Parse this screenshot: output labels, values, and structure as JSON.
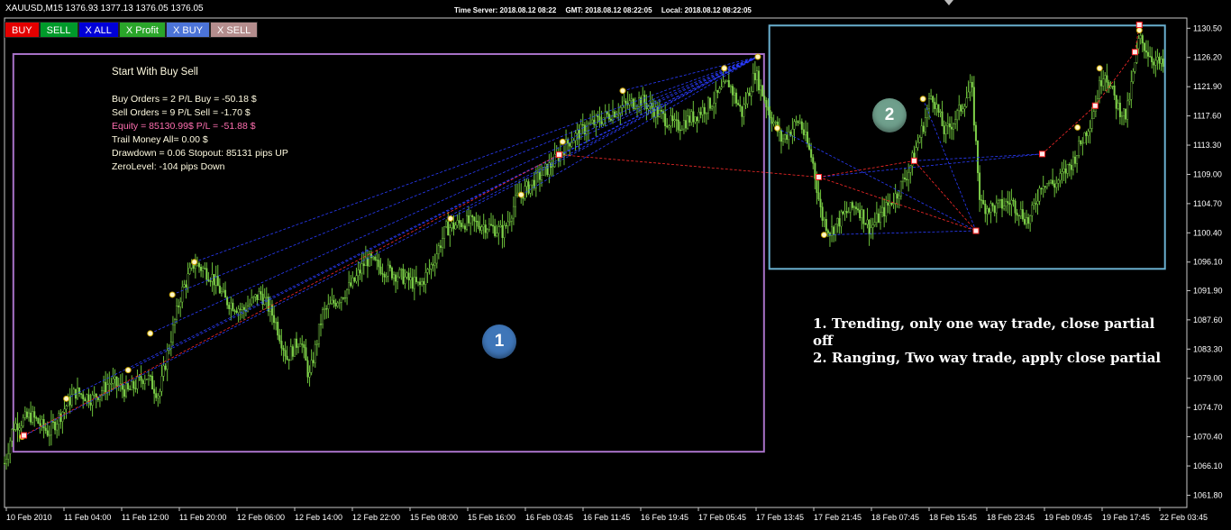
{
  "header": {
    "symbol_line": "XAUUSD,M15  1376.93 1377.13 1376.05 1376.05",
    "time_server": "Time Server: 2018.08.12 08:22",
    "gmt": "GMT: 2018.08.12 08:22:05",
    "local": "Local: 2018.08.12 08:22:05"
  },
  "toolbar": {
    "buttons": [
      {
        "label": "BUY",
        "color": "#e30000"
      },
      {
        "label": "SELL",
        "color": "#009a2a"
      },
      {
        "label": "X ALL",
        "color": "#0000d8"
      },
      {
        "label": "X Profit",
        "color": "#2aa52a"
      },
      {
        "label": "X BUY",
        "color": "#4c74d8"
      },
      {
        "label": "X SELL",
        "color": "#b48d8d"
      }
    ]
  },
  "info_panel": {
    "title": "Start With Buy Sell",
    "buy_orders": "Buy Orders = 2  P/L Buy = -50.18 $",
    "sell_orders": "Sell Orders = 9  P/L Sell = -1.70 $",
    "equity": "Equity = 85130.99$ P/L = -51.88 $",
    "trail_money": "Trail Money All= 0.00 $",
    "drawdown": "Drawdown = 0.06  Stopout: 85131 pips UP",
    "zero_level": "ZeroLevel: -104 pips Down",
    "equity_color": "#ff6fb0"
  },
  "annotations": {
    "badge_1": "1",
    "badge_2": "2",
    "badge_1_color": "#3f76b8",
    "badge_2_color": "#6f9f8c",
    "box_1_color": "#a872c8",
    "box_2_color": "#6ab0d0",
    "note_1": "1. Trending, only one way trade, close partial off",
    "note_2": "2. Ranging, Two way trade, apply close partial"
  },
  "chart_data": {
    "type": "candlestick",
    "symbol": "XAUUSD",
    "timeframe": "M15",
    "ylim": [
      1060.0,
      1132.0
    ],
    "y_ticks": [
      "1130.50",
      "1126.20",
      "1121.90",
      "1117.60",
      "1113.30",
      "1109.00",
      "1104.70",
      "1100.40",
      "1096.10",
      "1091.90",
      "1087.60",
      "1083.30",
      "1079.00",
      "1074.70",
      "1070.40",
      "1066.10",
      "1061.80"
    ],
    "x_ticks": [
      "10 Feb 2010",
      "11 Feb 04:00",
      "11 Feb 12:00",
      "11 Feb 20:00",
      "12 Feb 06:00",
      "12 Feb 14:00",
      "12 Feb 22:00",
      "15 Feb 08:00",
      "15 Feb 16:00",
      "16 Feb 03:45",
      "16 Feb 11:45",
      "16 Feb 19:45",
      "17 Feb 05:45",
      "17 Feb 13:45",
      "17 Feb 21:45",
      "18 Feb 07:45",
      "18 Feb 15:45",
      "18 Feb 23:45",
      "19 Feb 09:45",
      "19 Feb 17:45",
      "22 Feb 03:45"
    ],
    "price_path": [
      [
        0.0,
        1066.5
      ],
      [
        0.01,
        1072.0
      ],
      [
        0.03,
        1073.5
      ],
      [
        0.05,
        1071.0
      ],
      [
        0.08,
        1077.0
      ],
      [
        0.1,
        1076.0
      ],
      [
        0.12,
        1078.5
      ],
      [
        0.14,
        1077.0
      ],
      [
        0.16,
        1079.5
      ],
      [
        0.175,
        1076.5
      ],
      [
        0.185,
        1083.0
      ],
      [
        0.2,
        1091.5
      ],
      [
        0.215,
        1096.0
      ],
      [
        0.235,
        1094.0
      ],
      [
        0.25,
        1090.5
      ],
      [
        0.27,
        1089.0
      ],
      [
        0.29,
        1091.5
      ],
      [
        0.305,
        1088.0
      ],
      [
        0.32,
        1082.0
      ],
      [
        0.335,
        1085.0
      ],
      [
        0.345,
        1079.0
      ],
      [
        0.36,
        1088.5
      ],
      [
        0.38,
        1091.0
      ],
      [
        0.395,
        1093.0
      ],
      [
        0.41,
        1096.5
      ],
      [
        0.43,
        1095.0
      ],
      [
        0.45,
        1094.0
      ],
      [
        0.47,
        1092.5
      ],
      [
        0.485,
        1096.0
      ],
      [
        0.5,
        1101.0
      ],
      [
        0.52,
        1102.0
      ],
      [
        0.545,
        1101.5
      ],
      [
        0.565,
        1100.5
      ],
      [
        0.58,
        1105.5
      ],
      [
        0.6,
        1108.0
      ],
      [
        0.62,
        1110.5
      ],
      [
        0.64,
        1114.0
      ],
      [
        0.66,
        1116.0
      ],
      [
        0.68,
        1117.5
      ],
      [
        0.7,
        1119.0
      ],
      [
        0.72,
        1120.0
      ],
      [
        0.74,
        1118.0
      ],
      [
        0.76,
        1116.0
      ],
      [
        0.78,
        1117.5
      ],
      [
        0.8,
        1119.5
      ],
      [
        0.82,
        1122.5
      ],
      [
        0.835,
        1118.0
      ],
      [
        0.85,
        1124.0
      ],
      [
        0.865,
        1118.5
      ],
      [
        0.88,
        1114.0
      ],
      [
        0.9,
        1117.0
      ],
      [
        0.915,
        1111.0
      ],
      [
        0.925,
        1103.0
      ],
      [
        0.935,
        1100.5
      ],
      [
        0.95,
        1103.0
      ],
      [
        0.965,
        1104.5
      ],
      [
        0.98,
        1101.0
      ],
      [
        0.995,
        1103.5
      ],
      [
        1.01,
        1106.0
      ],
      [
        1.025,
        1110.0
      ],
      [
        1.04,
        1116.0
      ],
      [
        1.05,
        1121.0
      ],
      [
        1.065,
        1115.0
      ],
      [
        1.08,
        1118.0
      ],
      [
        1.095,
        1122.0
      ],
      [
        1.105,
        1104.5
      ],
      [
        1.12,
        1104.0
      ],
      [
        1.14,
        1105.0
      ],
      [
        1.16,
        1102.0
      ],
      [
        1.175,
        1108.0
      ],
      [
        1.19,
        1107.5
      ],
      [
        1.21,
        1111.0
      ],
      [
        1.23,
        1117.0
      ],
      [
        1.245,
        1124.5
      ],
      [
        1.26,
        1119.0
      ],
      [
        1.27,
        1117.5
      ],
      [
        1.285,
        1129.0
      ],
      [
        1.3,
        1126.0
      ],
      [
        1.315,
        1124.5
      ]
    ],
    "orders": {
      "buy": [
        [
          0.02,
          1070.4
        ],
        [
          0.07,
          1076.0
        ],
        [
          0.14,
          1080.2
        ],
        [
          0.165,
          1085.6
        ],
        [
          0.19,
          1091.3
        ],
        [
          0.215,
          1096.1
        ],
        [
          0.505,
          1102.5
        ],
        [
          0.585,
          1106.0
        ],
        [
          0.632,
          1113.8
        ],
        [
          0.7,
          1121.3
        ],
        [
          0.815,
          1124.6
        ],
        [
          0.853,
          1126.3
        ],
        [
          0.875,
          1115.8
        ],
        [
          0.928,
          1100.1
        ],
        [
          1.04,
          1120.1
        ],
        [
          1.215,
          1115.9
        ],
        [
          1.24,
          1124.6
        ],
        [
          1.285,
          1130.2
        ]
      ],
      "sell": [
        [
          0.022,
          1070.6
        ],
        [
          0.628,
          1111.9
        ],
        [
          0.922,
          1108.6
        ],
        [
          1.03,
          1111.0
        ],
        [
          1.1,
          1100.7
        ],
        [
          1.175,
          1112.0
        ],
        [
          1.235,
          1119.1
        ],
        [
          1.28,
          1127.0
        ],
        [
          1.285,
          1131.0
        ]
      ]
    }
  }
}
